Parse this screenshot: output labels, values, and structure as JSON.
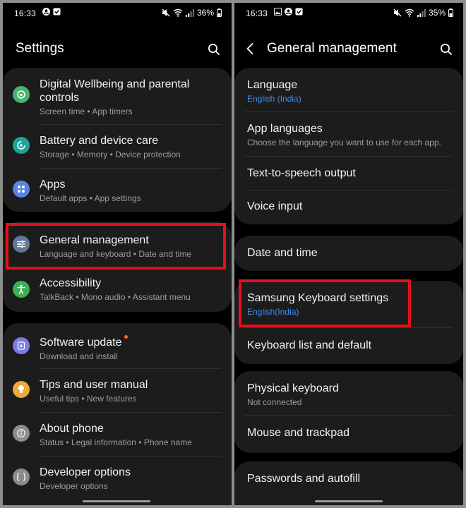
{
  "left": {
    "status": {
      "time": "16:33",
      "battery": "36%"
    },
    "title": "Settings",
    "items": [
      {
        "title": "Digital Wellbeing and parental",
        "title2": "controls",
        "subtitle": "Screen time  •  App timers"
      },
      {
        "title": "Battery and device care",
        "subtitle": "Storage  •  Memory  •  Device protection"
      },
      {
        "title": "Apps",
        "subtitle": "Default apps  •  App settings"
      },
      {
        "title": "General management",
        "subtitle": "Language and keyboard  •  Date and time"
      },
      {
        "title": "Accessibility",
        "subtitle": "TalkBack  •  Mono audio  •  Assistant menu"
      },
      {
        "title": "Software update",
        "subtitle": "Download and install"
      },
      {
        "title": "Tips and user manual",
        "subtitle": "Useful tips  •  New features"
      },
      {
        "title": "About phone",
        "subtitle": "Status  •  Legal information  •  Phone name"
      },
      {
        "title": "Developer options",
        "subtitle": "Developer options"
      }
    ]
  },
  "right": {
    "status": {
      "time": "16:33",
      "battery": "35%"
    },
    "title": "General management",
    "items": [
      {
        "title": "Language",
        "subtitle": "English (India)"
      },
      {
        "title": "App languages",
        "subtitle": "Choose the language you want to use for each app."
      },
      {
        "title": "Text-to-speech output"
      },
      {
        "title": "Voice input"
      },
      {
        "title": "Date and time"
      },
      {
        "title": "Samsung Keyboard settings",
        "subtitle": "English(India)"
      },
      {
        "title": "Keyboard list and default"
      },
      {
        "title": "Physical keyboard",
        "subtitle": "Not connected"
      },
      {
        "title": "Mouse and trackpad"
      },
      {
        "title": "Passwords and autofill"
      }
    ]
  },
  "colors": {
    "accent_blue": "#3d8fef",
    "highlight_red": "#e3101d",
    "card_bg": "#1c1c1c",
    "notification_dot": "#ff6a23"
  },
  "icons": {
    "left": [
      "digital-wellbeing-icon",
      "battery-care-icon",
      "apps-icon",
      "general-management-icon",
      "accessibility-icon",
      "software-update-icon",
      "tips-icon",
      "about-phone-icon",
      "developer-options-icon"
    ],
    "header": [
      "search-icon",
      "back-arrow-icon"
    ]
  }
}
